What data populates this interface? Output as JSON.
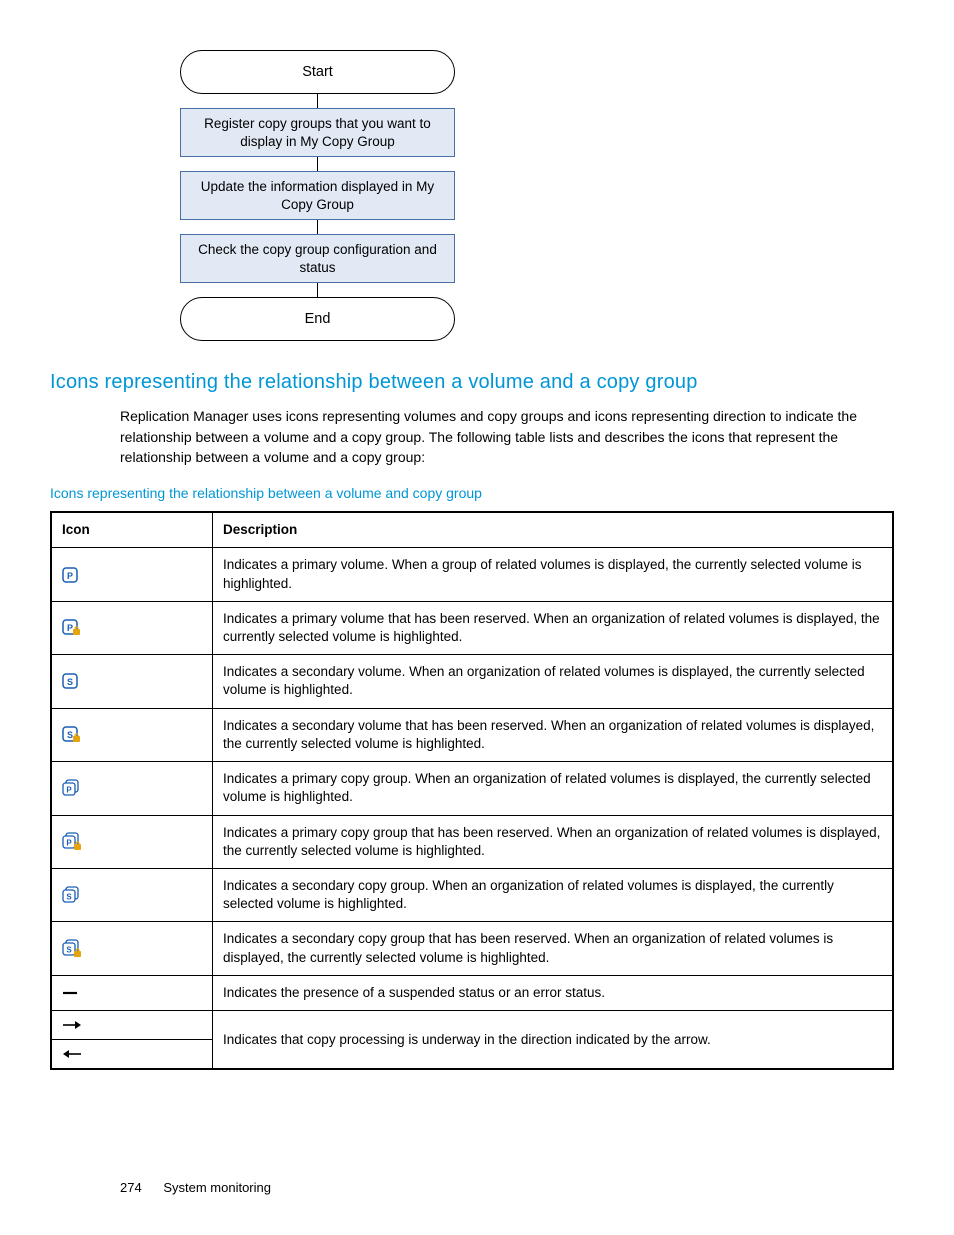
{
  "flowchart": {
    "start": "Start",
    "step1": "Register copy groups that you want to display in My Copy Group",
    "step2": "Update the information displayed in My Copy Group",
    "step3": "Check the copy group configuration and status",
    "end": "End"
  },
  "heading": "Icons representing the relationship between a volume and a copy group",
  "paragraph": "Replication Manager uses icons representing volumes and copy groups and icons representing direction to indicate the relationship between a volume and a copy group. The following table lists and describes the icons that represent the relationship between a volume and a copy group:",
  "table_title": "Icons representing the relationship between a volume and copy group",
  "columns": {
    "icon": "Icon",
    "desc": "Description"
  },
  "rows": [
    {
      "icon": "primary-volume-icon",
      "desc": "Indicates a primary volume. When a group of related volumes is displayed, the currently selected volume is highlighted."
    },
    {
      "icon": "primary-volume-reserved-icon",
      "desc": "Indicates a primary volume that has been reserved. When an organization of related volumes is displayed, the currently selected volume is highlighted."
    },
    {
      "icon": "secondary-volume-icon",
      "desc": "Indicates a secondary volume. When an organization of related volumes is displayed, the currently selected volume is highlighted."
    },
    {
      "icon": "secondary-volume-reserved-icon",
      "desc": "Indicates a secondary volume that has been reserved. When an organization of related volumes is displayed, the currently selected volume is highlighted."
    },
    {
      "icon": "primary-copy-group-icon",
      "desc": "Indicates a primary copy group. When an organization of related volumes is displayed, the currently selected volume is highlighted."
    },
    {
      "icon": "primary-copy-group-reserved-icon",
      "desc": "Indicates a primary copy group that has been reserved. When an organization of related volumes is displayed, the currently selected volume is highlighted."
    },
    {
      "icon": "secondary-copy-group-icon",
      "desc": "Indicates a secondary copy group. When an organization of related volumes is displayed, the currently selected volume is highlighted."
    },
    {
      "icon": "secondary-copy-group-reserved-icon",
      "desc": "Indicates a secondary copy group that has been reserved. When an organization of related volumes is displayed, the currently selected volume is highlighted."
    },
    {
      "icon": "suspended-error-status-icon",
      "desc": "Indicates the presence of a suspended status or an error status."
    },
    {
      "icon": "arrow-right-icon",
      "desc": "Indicates that copy processing is underway in the direction indicated by the arrow."
    },
    {
      "icon": "arrow-left-icon",
      "desc": ""
    }
  ],
  "footer": {
    "page": "274",
    "section": "System monitoring"
  }
}
